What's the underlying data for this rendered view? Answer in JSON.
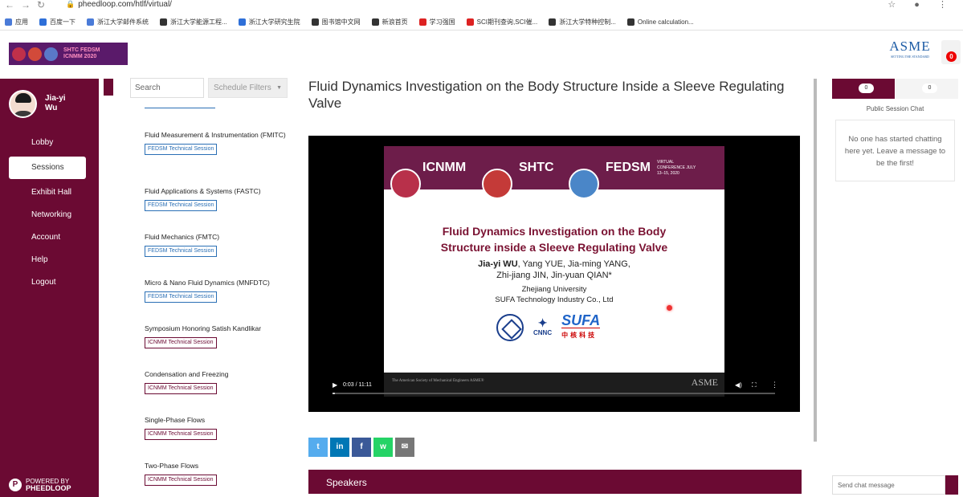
{
  "browser": {
    "url": "pheedloop.com/htlf/virtual/",
    "bookmarks": [
      "应用",
      "百度一下",
      "浙江大学邮件系统",
      "浙江大学能源工程...",
      "浙江大学研究生院",
      "图书馆中文网",
      "新浪首页",
      "学习强国",
      "SCI期刊查询,SCI催...",
      "浙江大学特种控制...",
      "Online calculation..."
    ]
  },
  "header": {
    "conference_logo_text": [
      "SHTC",
      "ICNMM",
      "FEDSM",
      "2020"
    ],
    "sponsor_logo": "ASME",
    "sponsor_tagline": "SETTING THE STANDARD",
    "cart_count": "0"
  },
  "sidebar": {
    "user_name": "Jia-yi Wu",
    "menu": [
      "Lobby",
      "Sessions",
      "Exhibit Hall",
      "Networking",
      "Account",
      "Help",
      "Logout"
    ],
    "active_item": "Sessions",
    "powered_by": "POWERED BY",
    "powered_brand": "PHEEDLOOP"
  },
  "filters": {
    "search_placeholder": "Search",
    "schedule_filters": "Schedule Filters"
  },
  "tracks": [
    {
      "title": "Fluid Measurement & Instrumentation (FMITC)",
      "tag": "FEDSM Technical Session",
      "kind": "fedsm"
    },
    {
      "title": "Fluid Applications & Systems (FASTC)",
      "tag": "FEDSM Technical Session",
      "kind": "fedsm"
    },
    {
      "title": "Fluid Mechanics (FMTC)",
      "tag": "FEDSM Technical Session",
      "kind": "fedsm"
    },
    {
      "title": "Micro & Nano Fluid Dynamics (MNFDTC)",
      "tag": "FEDSM Technical Session",
      "kind": "fedsm"
    },
    {
      "title": "Symposium Honoring Satish Kandlikar",
      "tag": "ICNMM Technical Session",
      "kind": "icnmm"
    },
    {
      "title": "Condensation and Freezing",
      "tag": "ICNMM Technical Session",
      "kind": "icnmm"
    },
    {
      "title": "Single-Phase Flows",
      "tag": "ICNMM Technical Session",
      "kind": "icnmm"
    },
    {
      "title": "Two-Phase Flows",
      "tag": "ICNMM Technical Session",
      "kind": "icnmm"
    }
  ],
  "session": {
    "title": "Fluid Dynamics Investigation on the Body Structure Inside a Sleeve Regulating Valve",
    "slide": {
      "banner": [
        "ICNMM",
        "SHTC",
        "FEDSM"
      ],
      "banner_note": "VIRTUAL CONFERENCE JULY 13–15, 2020",
      "title_line1": "Fluid Dynamics Investigation on the Body",
      "title_line2": "Structure inside a Sleeve Regulating Valve",
      "author_first": "Jia-yi WU",
      "authors_rest": ", Yang YUE, Jia-ming YANG,",
      "authors_line2": "Zhi-jiang JIN, Jin-yuan QIAN*",
      "affiliation1": "Zhejiang University",
      "affiliation2": "SUFA Technology Industry Co., Ltd",
      "logo_cnnc": "CNNC",
      "logo_sufa": "SUFA",
      "logo_sufa_cn": "中核科技",
      "footer_society": "The American Society of Mechanical Engineers ASME®",
      "footer_logo": "ASME"
    },
    "video": {
      "time": "0:03 / 11:11",
      "progress": 0.005
    },
    "share": [
      "t",
      "in",
      "f",
      "w",
      "✉"
    ],
    "speakers_label": "Speakers"
  },
  "chat": {
    "tab_public_count": "0",
    "tab_private_count": "0",
    "heading": "Public Session Chat",
    "empty_message": "No one has started chatting here yet. Leave a message to be the first!",
    "input_placeholder": "Send chat message"
  },
  "colors": {
    "brand": "#6b0a33",
    "fedsm_tag": "#2a6fb5",
    "icnmm_tag": "#6b0a33"
  }
}
